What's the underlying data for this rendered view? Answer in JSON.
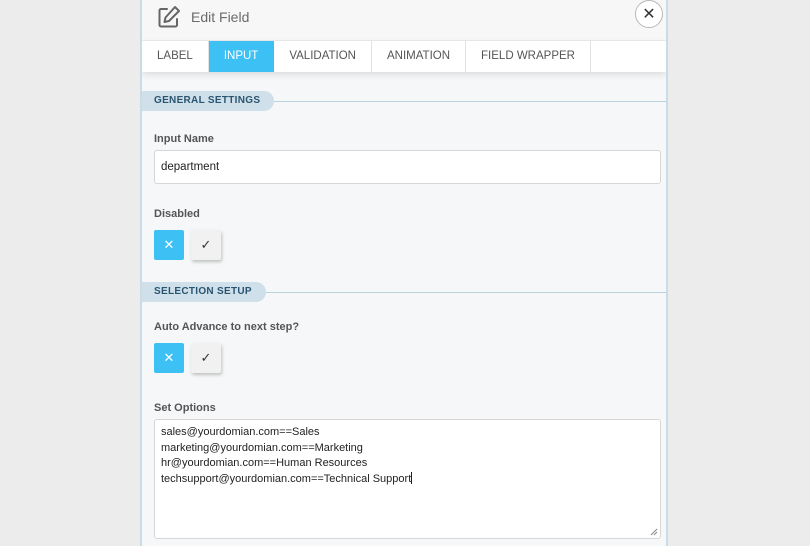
{
  "header": {
    "title": "Edit Field",
    "close_label": "✕",
    "icons": {
      "edit": "edit-pencil-square-icon",
      "close": "close-icon"
    }
  },
  "tabs": [
    {
      "label": "LABEL",
      "active": false
    },
    {
      "label": "INPUT",
      "active": true
    },
    {
      "label": "VALIDATION",
      "active": false
    },
    {
      "label": "ANIMATION",
      "active": false
    },
    {
      "label": "FIELD WRAPPER",
      "active": false
    }
  ],
  "general_settings": {
    "heading": "GENERAL SETTINGS",
    "input_name": {
      "label": "Input Name",
      "value": "department"
    },
    "disabled": {
      "label": "Disabled",
      "no_glyph": "✕",
      "yes_glyph": "✓",
      "selected": "no"
    }
  },
  "selection_setup": {
    "heading": "SELECTION SETUP",
    "auto_advance": {
      "label": "Auto Advance to next step?",
      "no_glyph": "✕",
      "yes_glyph": "✓",
      "selected": "no"
    },
    "set_options": {
      "label": "Set Options",
      "lines": [
        "sales@yourdomian.com==Sales",
        "marketing@yourdomian.com==Marketing",
        "hr@yourdomian.com==Human Resources",
        "techsupport@yourdomian.com==Technical Support"
      ]
    }
  },
  "colors": {
    "accent": "#3dc1f5",
    "section_pill": "#cfe0ea",
    "panel_bg": "#f5f7f8"
  }
}
